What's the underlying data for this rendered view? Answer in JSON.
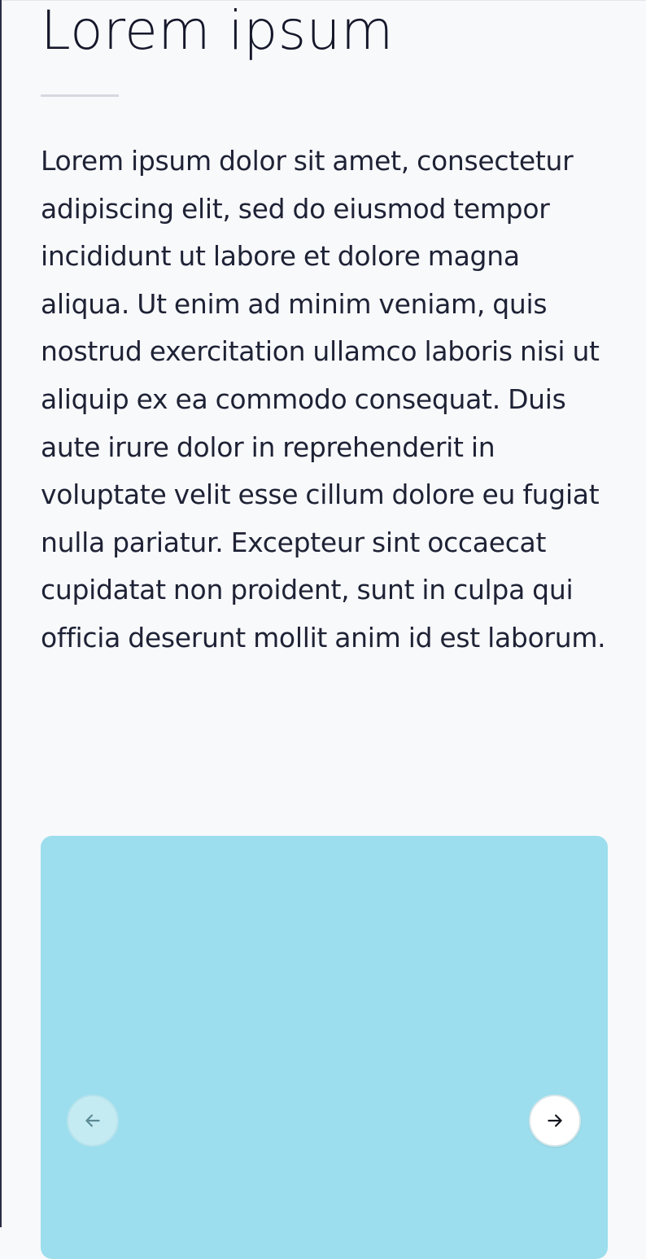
{
  "article": {
    "title": "Lorem ipsum",
    "body": "Lorem ipsum dolor sit amet, consectetur adipiscing elit, sed do eiusmod tempor incididunt ut labore et dolore magna aliqua. Ut enim ad minim veniam, quis nostrud exercitation ullamco laboris nisi ut aliquip ex ea commodo consequat. Duis aute irure dolor in reprehenderit in voluptate velit esse cillum dolore eu fugiat nulla pariatur. Excepteur sint occaecat cupidatat non proident, sunt in culpa qui officia deserunt mollit anim id est laborum."
  },
  "carousel": {
    "slide_color": "#9cdeed",
    "prev_icon": "arrow-left-icon",
    "next_icon": "arrow-right-icon"
  },
  "colors": {
    "page_background": "#f8f9fb",
    "text": "#1e2235",
    "divider": "#d6d8e0"
  }
}
